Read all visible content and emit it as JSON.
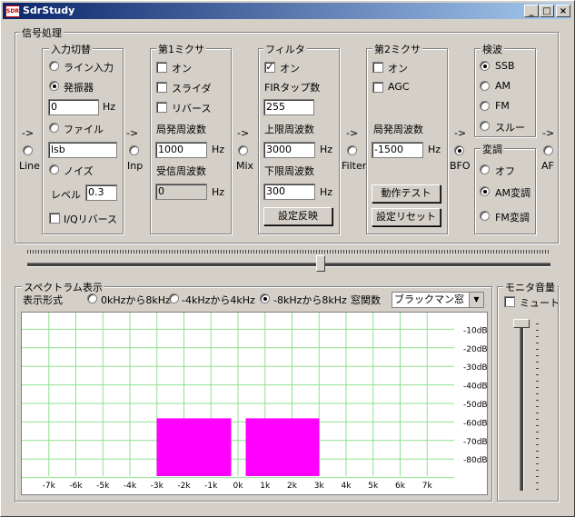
{
  "window": {
    "title": "SdrStudy",
    "icon_text": "SDR",
    "minimize": "_",
    "maximize": "□",
    "close": "×"
  },
  "signal_group": {
    "title": "信号処理"
  },
  "input": {
    "title": "入力切替",
    "opt_line": "ライン入力",
    "opt_osc": "発振器",
    "osc_freq": "0",
    "hz": "Hz",
    "opt_file": "ファイル",
    "file_value": "lsb",
    "opt_noise": "ノイズ",
    "level_label": "レベル",
    "level_value": "0.3",
    "iq_reverse": "I/Qリバース"
  },
  "mixer1": {
    "title": "第1ミクサ",
    "on": "オン",
    "slider": "スライダ",
    "reverse": "リバース",
    "lo_label": "局発周波数",
    "lo_value": "1000",
    "rx_label": "受信周波数",
    "rx_value": "0",
    "hz": "Hz"
  },
  "filter": {
    "title": "フィルタ",
    "on": "オン",
    "taps_label": "FIRタップ数",
    "taps_value": "255",
    "upper_label": "上限周波数",
    "upper_value": "3000",
    "lower_label": "下限周波数",
    "lower_value": "300",
    "hz": "Hz",
    "apply": "設定反映"
  },
  "mixer2": {
    "title": "第2ミクサ",
    "on": "オン",
    "agc": "AGC",
    "lo_label": "局発周波数",
    "lo_value": "-1500",
    "hz": "Hz",
    "test": "動作テスト",
    "reset": "設定リセット"
  },
  "detect": {
    "title": "検波",
    "ssb": "SSB",
    "am": "AM",
    "fm": "FM",
    "through": "スルー"
  },
  "modulate": {
    "title": "変調",
    "off": "オフ",
    "am": "AM変調",
    "fm": "FM変調"
  },
  "nodes": {
    "arrow": "->",
    "line": "Line",
    "inp": "Inp",
    "mix": "Mix",
    "filter": "Filter",
    "bfo": "BFO",
    "af": "AF"
  },
  "spectrum": {
    "title": "スペクトラム表示",
    "format_label": "表示形式",
    "opt1": "0kHzから8kHz",
    "opt2": "-4kHzから4kHz",
    "opt3": "-8kHzから8kHz",
    "window_label": "窓関数",
    "window_value": "ブラックマン窓",
    "db_labels": [
      "-10dB",
      "-20dB",
      "-30dB",
      "-40dB",
      "-50dB",
      "-60dB",
      "-70dB",
      "-80dB"
    ],
    "k_labels": [
      "-7k",
      "-6k",
      "-5k",
      "-4k",
      "-3k",
      "-2k",
      "-1k",
      "0k",
      "1k",
      "2k",
      "3k",
      "4k",
      "5k",
      "6k",
      "7k"
    ],
    "trace_color": "#ff00ff",
    "grid_color": "#90e090"
  },
  "monitor": {
    "title": "モニタ音量",
    "mute": "ミュート"
  }
}
